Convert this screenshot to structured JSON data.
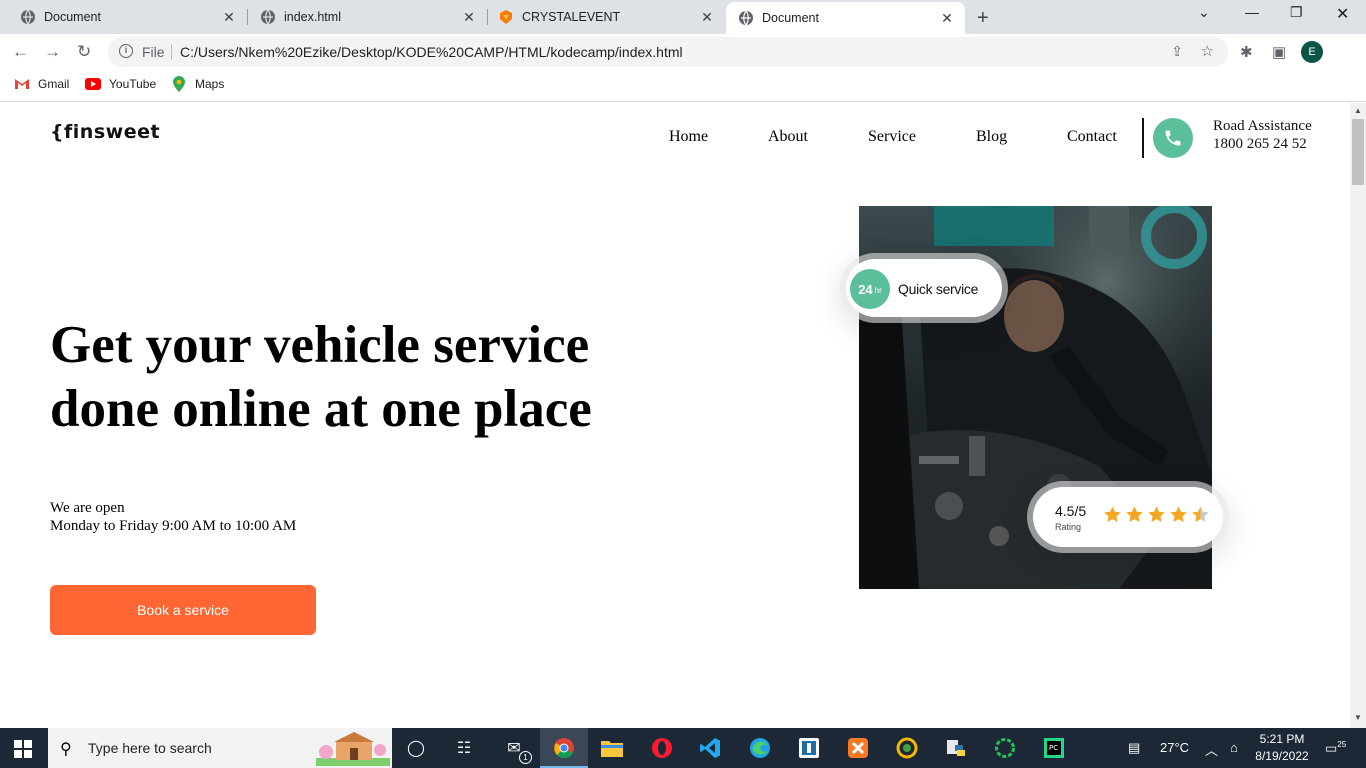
{
  "browser": {
    "tabs": [
      {
        "title": "Document",
        "icon": "globe-icon"
      },
      {
        "title": "index.html",
        "icon": "globe-icon"
      },
      {
        "title": "CRYSTALEVENT",
        "icon": "brand-icon"
      },
      {
        "title": "Document",
        "icon": "globe-icon",
        "active": true
      }
    ],
    "address": {
      "scheme_label": "File",
      "url": "C:/Users/Nkem%20Ezike/Desktop/KODE%20CAMP/HTML/kodecamp/index.html"
    },
    "profile_initial": "E",
    "bookmarks": [
      {
        "label": "Gmail",
        "icon": "gmail-icon"
      },
      {
        "label": "YouTube",
        "icon": "youtube-icon"
      },
      {
        "label": "Maps",
        "icon": "maps-icon"
      }
    ]
  },
  "site": {
    "logo": "{finsweet",
    "nav": [
      "Home",
      "About",
      "Service",
      "Blog",
      "Contact"
    ],
    "assist_label": "Road Assistance",
    "assist_phone": "1800 265 24 52",
    "hero_title": "Get your vehicle service done online at one place",
    "open_line1": "We are open",
    "open_line2": "Monday to Friday 9:00 AM to 10:00 AM",
    "cta": "Book a service",
    "quick_badge": {
      "hours": "24",
      "unit": "hr",
      "text": "Quick service"
    },
    "rating_badge": {
      "score": "4.5/5",
      "label": "Rating",
      "stars": 4.5,
      "max": 5
    },
    "accent": "#ff6633",
    "green": "#5bbf9a"
  },
  "taskbar": {
    "search_placeholder": "Type here to search",
    "mail_badge": "1",
    "weather": "27°C",
    "time": "5:21 PM",
    "date": "8/19/2022",
    "notifications": "25"
  }
}
